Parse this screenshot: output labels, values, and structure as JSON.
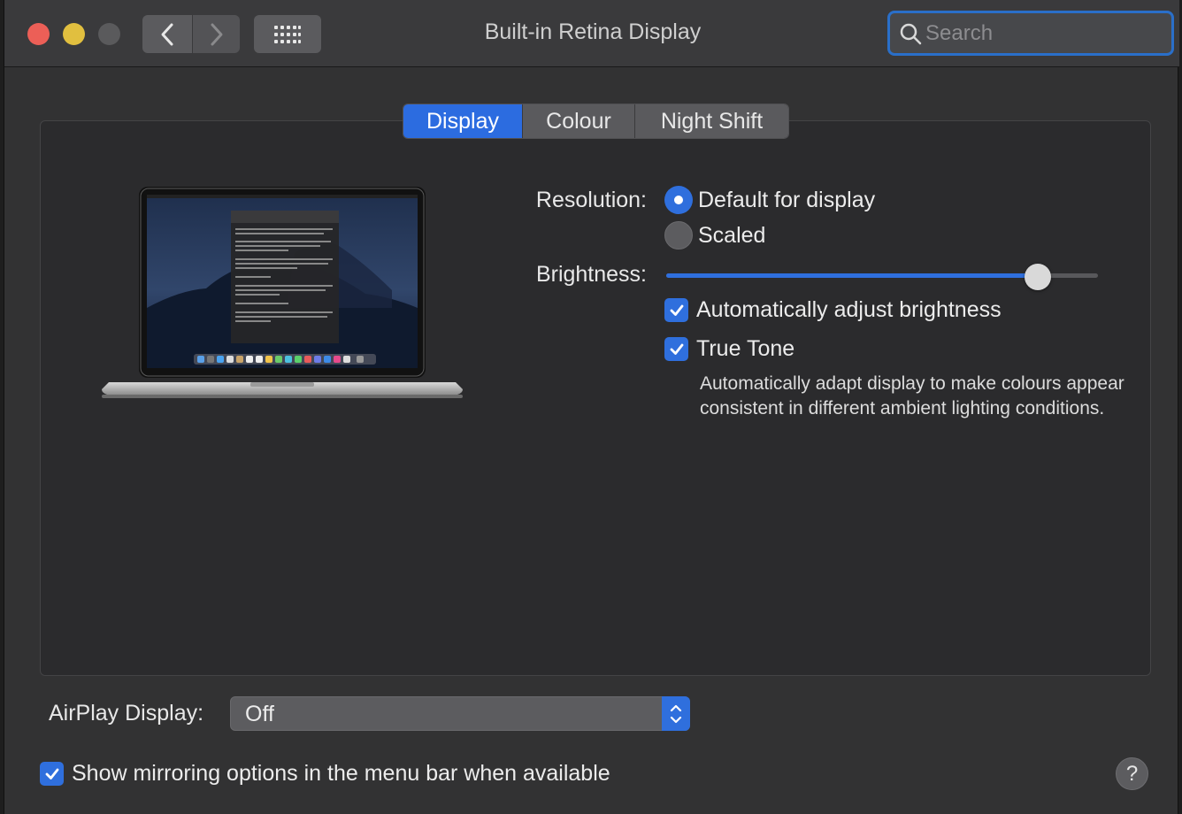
{
  "window": {
    "title": "Built-in Retina Display"
  },
  "search": {
    "placeholder": "Search"
  },
  "tabs": [
    {
      "label": "Display",
      "active": true
    },
    {
      "label": "Colour",
      "active": false
    },
    {
      "label": "Night Shift",
      "active": false
    }
  ],
  "resolution": {
    "label": "Resolution:",
    "options": [
      {
        "label": "Default for display",
        "selected": true
      },
      {
        "label": "Scaled",
        "selected": false
      }
    ]
  },
  "brightness": {
    "label": "Brightness:",
    "level_percent": 86
  },
  "auto_brightness": {
    "label": "Automatically adjust brightness",
    "checked": true
  },
  "true_tone": {
    "label": "True Tone",
    "checked": true,
    "description": "Automatically adapt display to make colours appear consistent in different ambient lighting conditions."
  },
  "airplay": {
    "label": "AirPlay Display:",
    "value": "Off"
  },
  "mirroring": {
    "label": "Show mirroring options in the menu bar when available",
    "checked": true
  },
  "help": {
    "label": "?"
  },
  "colors": {
    "accent": "#2f6fdd",
    "close": "#ec5f57",
    "minimize": "#e1bf3f",
    "window_bg": "#323233"
  }
}
